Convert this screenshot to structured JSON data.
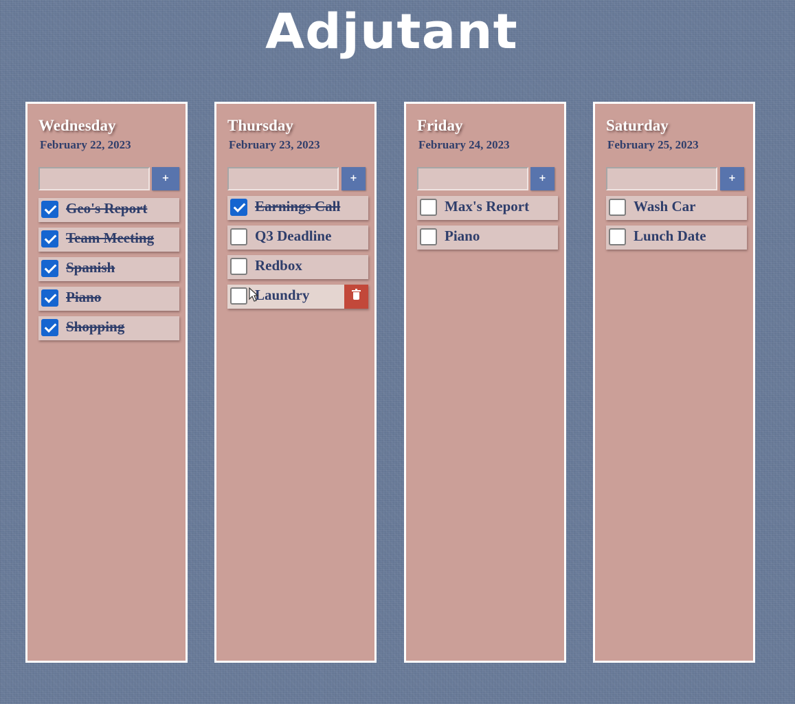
{
  "app": {
    "title": "Adjutant"
  },
  "days": [
    {
      "name": "Wednesday",
      "date": "February 22, 2023",
      "add_label": "+",
      "tasks": [
        {
          "label": "Geo's Report",
          "done": true
        },
        {
          "label": "Team Meeting",
          "done": true
        },
        {
          "label": "Spanish",
          "done": true
        },
        {
          "label": "Piano",
          "done": true
        },
        {
          "label": "Shopping",
          "done": true
        }
      ]
    },
    {
      "name": "Thursday",
      "date": "February 23, 2023",
      "add_label": "+",
      "tasks": [
        {
          "label": "Earnings Call",
          "done": true
        },
        {
          "label": "Q3 Deadline",
          "done": false
        },
        {
          "label": "Redbox",
          "done": false
        },
        {
          "label": "Laundry",
          "done": false,
          "hovered": true,
          "delete_icon": "trash-icon"
        }
      ]
    },
    {
      "name": "Friday",
      "date": "February 24, 2023",
      "add_label": "+",
      "tasks": [
        {
          "label": "Max's Report",
          "done": false
        },
        {
          "label": "Piano",
          "done": false
        }
      ]
    },
    {
      "name": "Saturday",
      "date": "February 25, 2023",
      "add_label": "+",
      "tasks": [
        {
          "label": "Wash Car",
          "done": false
        },
        {
          "label": "Lunch Date",
          "done": false
        }
      ]
    }
  ],
  "colors": {
    "background": "#687a98",
    "column": "#cb9f98",
    "task": "#dbc5c2",
    "accent": "#5874ad",
    "checked": "#1565d0",
    "text": "#2f3e6b",
    "delete": "#c2483a"
  }
}
